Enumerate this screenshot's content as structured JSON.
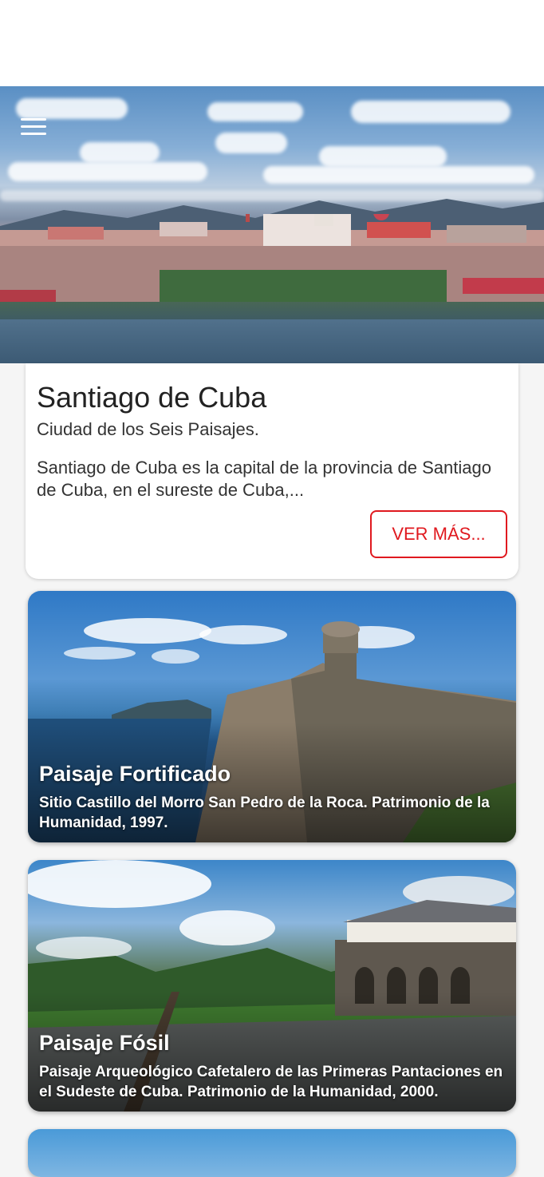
{
  "hero": {
    "menu_icon": "hamburger-menu-icon"
  },
  "intro": {
    "title": "Santiago de Cuba",
    "subtitle": "Ciudad de los Seis Paisajes.",
    "description": "Santiago de Cuba es la capital de la provincia de Santiago de Cuba, en el sureste de Cuba,...",
    "more_label": "VER MÁS..."
  },
  "landscapes": [
    {
      "title": "Paisaje Fortificado",
      "caption": "Sitio Castillo del Morro San Pedro de la Roca. Patrimonio de la Humanidad, 1997."
    },
    {
      "title": "Paisaje Fósil",
      "caption": "Paisaje Arqueológico Cafetalero de las Primeras Pantaciones en el Sudeste de Cuba. Patrimonio de la Humanidad, 2000."
    }
  ],
  "colors": {
    "accent": "#e0191f",
    "card_background": "#ffffff",
    "page_background": "#f5f5f5"
  }
}
